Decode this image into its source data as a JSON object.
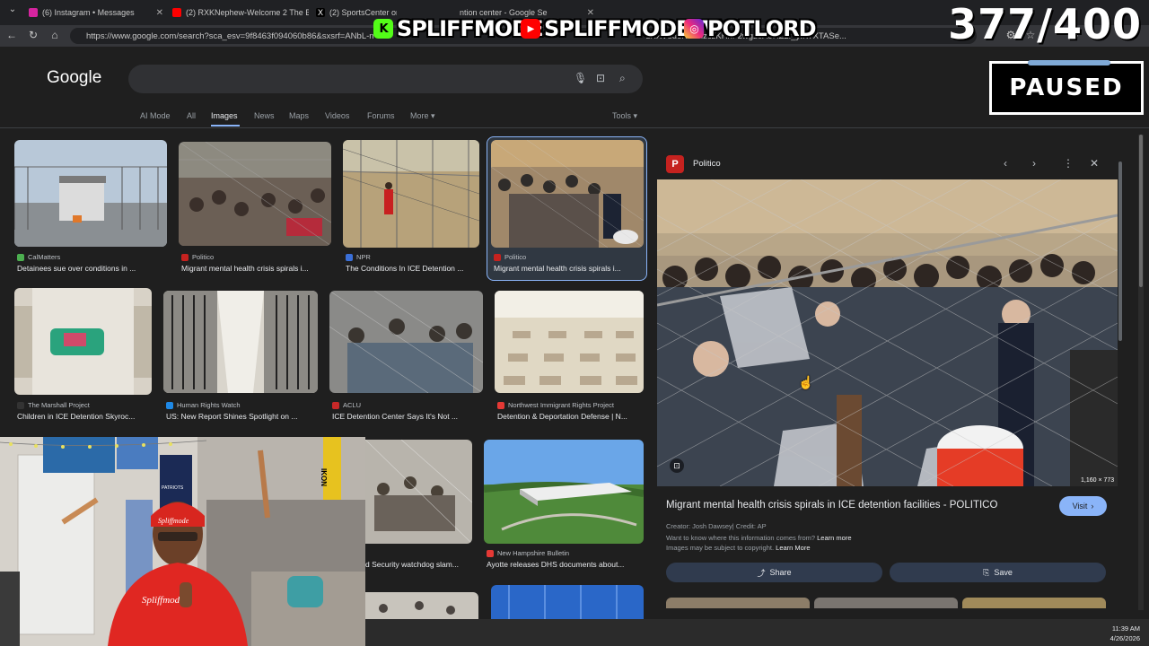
{
  "browser": {
    "tabs": [
      {
        "label": "(6) Instagram • Messages",
        "color": "#d6249f"
      },
      {
        "label": "(2) RXKNephew-Welcome 2 The B",
        "color": "#ff0000"
      },
      {
        "label": "(2) SportsCenter on X: ",
        "color": "#e8eaed"
      },
      {
        "label": "ntion center - Google Se",
        "color": "#8ab4f8"
      }
    ],
    "url": "https://www.google.com/search?sca_esv=9f8463f094060b86&sxsrf=ANbL-n",
    "url_tail": "1XXV8d8KvII3izczKHhF2wgz0AoHZ2f_yIK7XTASe..."
  },
  "overlay": {
    "logos": [
      {
        "text": "SPLIFFMODE",
        "icon": "kick-icon",
        "color": "#53fc18"
      },
      {
        "text": "SPLIFFMODETV",
        "icon": "youtube-icon",
        "color": "#ff0000"
      },
      {
        "text": "POTLORD",
        "icon": "instagram-icon",
        "color": "#d6249f"
      }
    ],
    "counter": "377/400",
    "paused": "PAUSED"
  },
  "google": {
    "logo": "Google",
    "tabs": [
      "AI Mode",
      "All",
      "Images",
      "News",
      "Maps",
      "Videos",
      "Forums",
      "More ▾"
    ],
    "active_tab": "Images",
    "tools": "Tools ▾"
  },
  "results": [
    {
      "source": "CalMatters",
      "title": "Detainees sue over conditions in ...",
      "fav": "#4caf50"
    },
    {
      "source": "Politico",
      "title": "Migrant mental health crisis spirals i...",
      "fav": "#c5221f"
    },
    {
      "source": "NPR",
      "title": "The Conditions In ICE Detention ...",
      "fav": "#3a6fd8"
    },
    {
      "source": "Politico",
      "title": "Migrant mental health crisis spirals i...",
      "fav": "#c5221f"
    },
    {
      "source": "The Marshall Project",
      "title": "Children in ICE Detention Skyroc...",
      "fav": "#333"
    },
    {
      "source": "Human Rights Watch",
      "title": "US: New Report Shines Spotlight on ...",
      "fav": "#1e88e5"
    },
    {
      "source": "ACLU",
      "title": "ICE Detention Center Says It's Not ...",
      "fav": "#c62828"
    },
    {
      "source": "Northwest Immigrant Rights Project",
      "title": "Detention & Deportation Defense | N...",
      "fav": "#e53935"
    },
    {
      "source": "",
      "title": "d Security watchdog slam...",
      "fav": "#888"
    },
    {
      "source": "New Hampshire Bulletin",
      "title": "Ayotte releases DHS documents about...",
      "fav": "#e53935"
    }
  ],
  "panel": {
    "source": "Politico",
    "favicon_letter": "P",
    "title": "Migrant mental health crisis spirals in ICE detention facilities - POLITICO",
    "visit": "Visit",
    "creator": "Creator: Josh Dawsey| Credit: AP",
    "info": "Want to know where this information comes from?",
    "info_link": "Learn more",
    "copyright": "Images may be subject to copyright.",
    "copyright_link": "Learn More",
    "dimensions": "1,160 × 773",
    "share": "Share",
    "save": "Save"
  },
  "webcam": {
    "hat_text": "Spliffmode",
    "hoodie_text": "Spliffmode",
    "pennant": "PATRIOTS",
    "ikon": "IKON"
  },
  "taskbar": {
    "time": "11:39 AM",
    "date": "4/26/2026"
  }
}
